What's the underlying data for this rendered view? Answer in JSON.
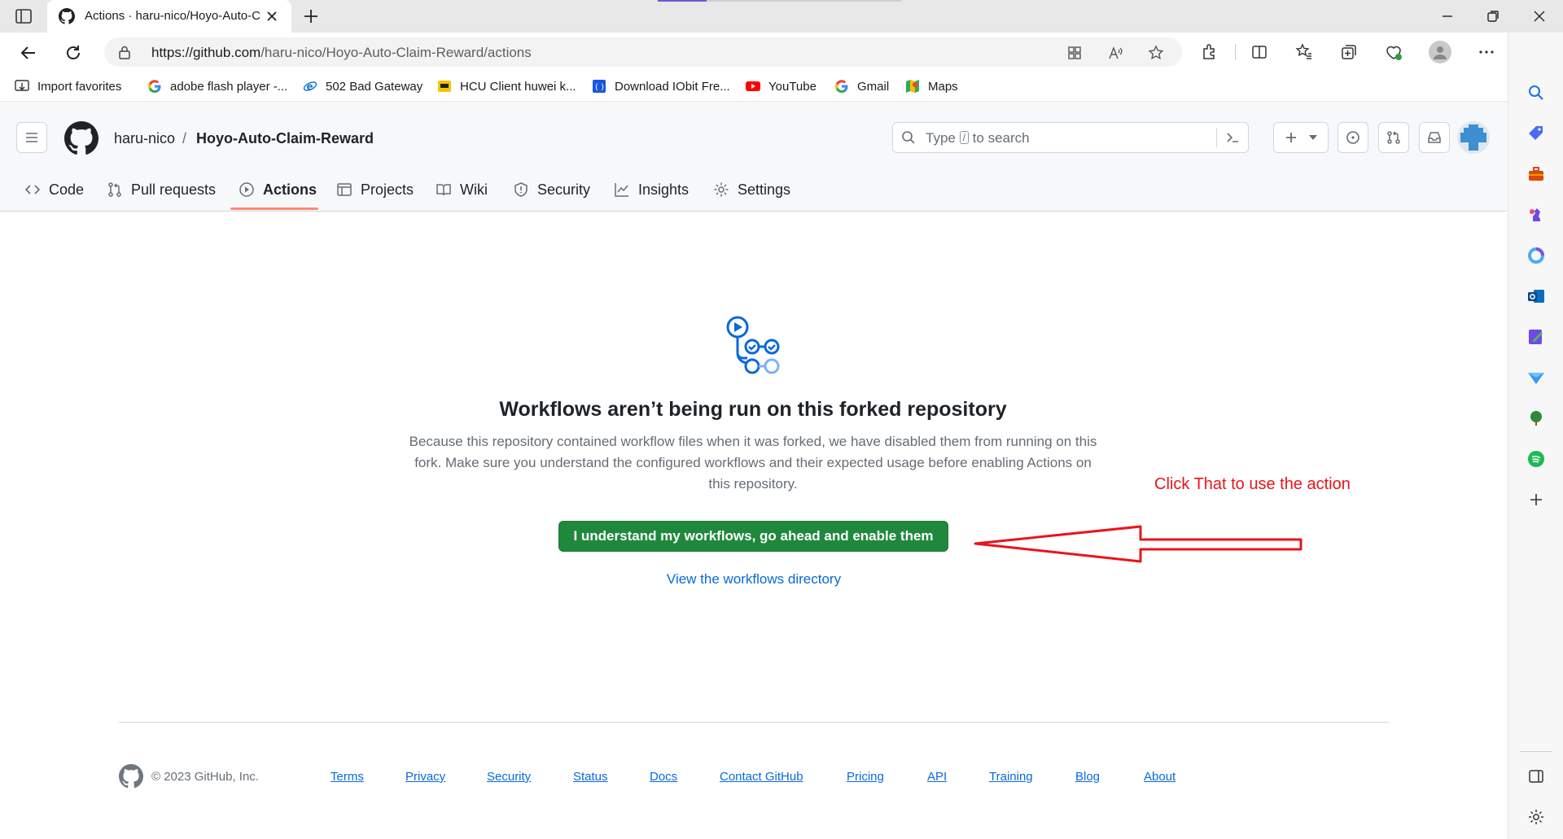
{
  "browser": {
    "tab_title": "Actions · haru-nico/Hoyo-Auto-C",
    "url_host": "https://github.com",
    "url_path": "/haru-nico/Hoyo-Auto-Claim-Reward/actions"
  },
  "bookmarks": [
    {
      "label": "Import favorites",
      "icon": "import-icon"
    },
    {
      "label": "adobe flash player -...",
      "icon": "google-icon"
    },
    {
      "label": "502 Bad Gateway",
      "icon": "ie-icon"
    },
    {
      "label": "HCU Client huwei k...",
      "icon": "hcu-icon"
    },
    {
      "label": "Download IObit Fre...",
      "icon": "iobit-icon"
    },
    {
      "label": "YouTube",
      "icon": "youtube-icon"
    },
    {
      "label": "Gmail",
      "icon": "google-icon"
    },
    {
      "label": "Maps",
      "icon": "maps-icon"
    }
  ],
  "github": {
    "owner": "haru-nico",
    "separator": "/",
    "repo": "Hoyo-Auto-Claim-Reward",
    "search_type": "Type",
    "search_slash": "/",
    "search_rest": "to search",
    "nav": [
      "Code",
      "Pull requests",
      "Actions",
      "Projects",
      "Wiki",
      "Security",
      "Insights",
      "Settings"
    ],
    "active_tab": "Actions"
  },
  "main": {
    "title": "Workflows aren’t being run on this forked repository",
    "description": "Because this repository contained workflow files when it was forked, we have disabled them from running on this fork. Make sure you understand the configured workflows and their expected usage before enabling Actions on this repository.",
    "enable_button": "I understand my workflows, go ahead and enable them",
    "workflows_link": "View the workflows directory"
  },
  "annotation": {
    "text": "Click That to use the action",
    "color": "#e8141a"
  },
  "footer": {
    "copyright": "© 2023 GitHub, Inc.",
    "links": [
      "Terms",
      "Privacy",
      "Security",
      "Status",
      "Docs",
      "Contact GitHub",
      "Pricing",
      "API",
      "Training",
      "Blog",
      "About"
    ]
  },
  "colors": {
    "primary_button": "#1f883d",
    "link": "#0969da",
    "active_underline": "#fd8c73"
  }
}
